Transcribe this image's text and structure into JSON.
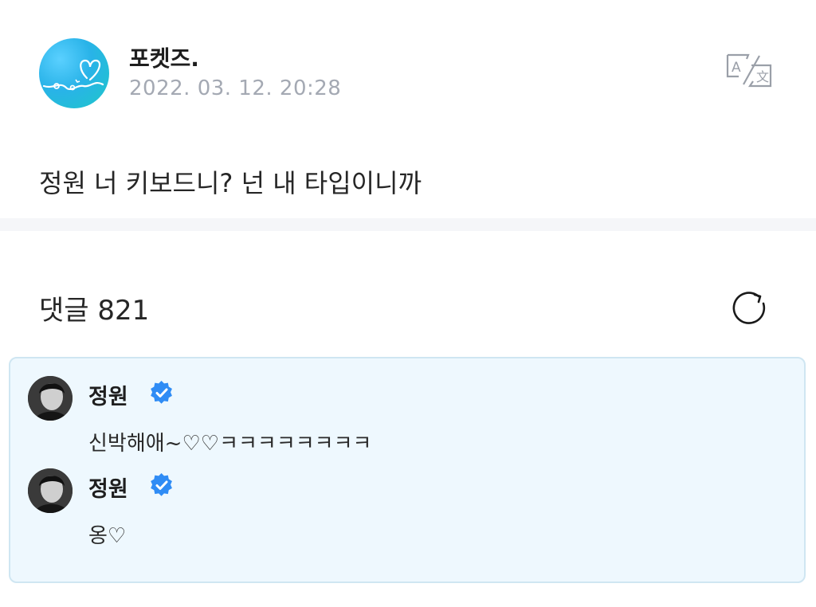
{
  "post": {
    "author": "포켓즈.",
    "date": "2022. 03. 12. 20:28",
    "text": "정원 너 키보드니? 넌 내 타입이니까",
    "translate_icon": "translate-icon"
  },
  "comments_section": {
    "label": "댓글",
    "count": "821",
    "refresh_icon": "refresh-icon"
  },
  "highlighted_comments": [
    {
      "author": "정원",
      "badge_icon": "verified-badge-icon",
      "text": "신박해애~♡♡ㅋㅋㅋㅋㅋㅋㅋㅋ"
    },
    {
      "author": "정원",
      "badge_icon": "verified-badge-icon",
      "text": "옹♡"
    }
  ],
  "colors": {
    "avatar_teal": "#29b3e8",
    "verified_blue": "#2f8cf5",
    "highlight_bg": "#eef8fe",
    "date_gray": "#a4a9b3"
  }
}
